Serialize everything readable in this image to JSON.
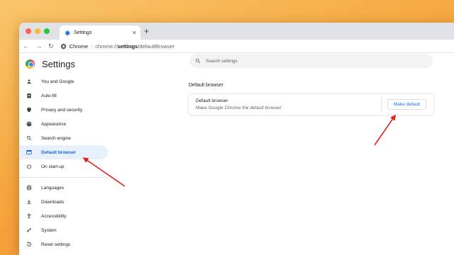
{
  "browser": {
    "tab_title": "Settings",
    "tab_close": "×",
    "new_tab": "+",
    "nav": {
      "back": "←",
      "forward": "→",
      "reload": "↻"
    },
    "omnibox": {
      "site_label": "Chrome",
      "separator": "|",
      "url_prefix": "chrome://",
      "url_bold": "settings",
      "url_suffix": "/defaultBrowser"
    }
  },
  "settings": {
    "title": "Settings",
    "search_placeholder": "Search settings",
    "sidebar": {
      "items": [
        {
          "label": "You and Google",
          "icon": "person-icon"
        },
        {
          "label": "Auto-fill",
          "icon": "clipboard-icon"
        },
        {
          "label": "Privacy and security",
          "icon": "shield-icon"
        },
        {
          "label": "Appearance",
          "icon": "palette-icon"
        },
        {
          "label": "Search engine",
          "icon": "search-icon"
        },
        {
          "label": "Default browser",
          "icon": "browser-icon",
          "active": true
        },
        {
          "label": "On start-up",
          "icon": "power-icon"
        },
        {
          "label": "Languages",
          "icon": "globe-icon"
        },
        {
          "label": "Downloads",
          "icon": "download-icon"
        },
        {
          "label": "Accessibility",
          "icon": "accessibility-icon"
        },
        {
          "label": "System",
          "icon": "wrench-icon"
        },
        {
          "label": "Reset settings",
          "icon": "reset-icon"
        }
      ]
    },
    "main": {
      "section_title": "Default browser",
      "card": {
        "title": "Default browser",
        "description": "Make Google Chrome the default browser",
        "button_label": "Make default"
      }
    }
  },
  "colors": {
    "accent": "#1a73e8",
    "active_bg": "#e8f0fe",
    "annotation_arrow": "#e0241b",
    "wallpaper": "#f6a63e"
  }
}
